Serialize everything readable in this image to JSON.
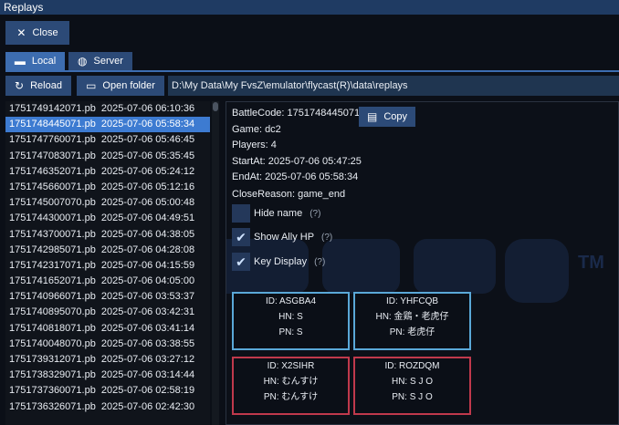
{
  "window": {
    "title": "Replays"
  },
  "toolbar": {
    "close_label": "Close"
  },
  "tabs": [
    {
      "label": "Local",
      "active": true
    },
    {
      "label": "Server",
      "active": false
    }
  ],
  "actions": {
    "reload_label": "Reload",
    "open_folder_label": "Open folder"
  },
  "path": "D:\\My Data\\My FvsZ\\emulator\\flycast(R)\\data\\replays",
  "replays": [
    {
      "label": "1751749142071.pb  2025-07-06 06:10:36"
    },
    {
      "label": "1751748445071.pb  2025-07-06 05:58:34",
      "selected": true
    },
    {
      "label": "1751747760071.pb  2025-07-06 05:46:45"
    },
    {
      "label": "1751747083071.pb  2025-07-06 05:35:45"
    },
    {
      "label": "1751746352071.pb  2025-07-06 05:24:12"
    },
    {
      "label": "1751745660071.pb  2025-07-06 05:12:16"
    },
    {
      "label": "1751745007070.pb  2025-07-06 05:00:48"
    },
    {
      "label": "1751744300071.pb  2025-07-06 04:49:51"
    },
    {
      "label": "1751743700071.pb  2025-07-06 04:38:05"
    },
    {
      "label": "1751742985071.pb  2025-07-06 04:28:08"
    },
    {
      "label": "1751742317071.pb  2025-07-06 04:15:59"
    },
    {
      "label": "1751741652071.pb  2025-07-06 04:05:00"
    },
    {
      "label": "1751740966071.pb  2025-07-06 03:53:37"
    },
    {
      "label": "1751740895070.pb  2025-07-06 03:42:31"
    },
    {
      "label": "1751740818071.pb  2025-07-06 03:41:14"
    },
    {
      "label": "1751740048070.pb  2025-07-06 03:38:55"
    },
    {
      "label": "1751739312071.pb  2025-07-06 03:27:12"
    },
    {
      "label": "1751738329071.pb  2025-07-06 03:14:44"
    },
    {
      "label": "1751737360071.pb  2025-07-06 02:58:19"
    },
    {
      "label": "1751736326071.pb  2025-07-06 02:42:30"
    }
  ],
  "details": {
    "battle_code": "BattleCode: 1751748445071",
    "copy_label": "Copy",
    "game": "Game: dc2",
    "players": "Players: 4",
    "start_at": "StartAt: 2025-07-06 05:47:25",
    "end_at": "EndAt: 2025-07-06 05:58:34",
    "close_reason": "CloseReason: game_end",
    "options": [
      {
        "label": "Hide name",
        "checked": false,
        "help": "(?)"
      },
      {
        "label": "Show Ally HP",
        "checked": true,
        "help": "(?)"
      },
      {
        "label": "Key Display",
        "checked": true,
        "help": "(?)"
      }
    ],
    "watermark": "TM"
  },
  "players": [
    {
      "team": "blue",
      "id": "ID: ASGBA4",
      "hn_label": "HN:",
      "hn": "S",
      "pn_label": "PN:",
      "pn": "S"
    },
    {
      "team": "blue",
      "id": "ID: YHFCQB",
      "hn_label": "HN:",
      "hn": "金鶏・老虎仔",
      "pn_label": "PN:",
      "pn": "老虎仔"
    },
    {
      "team": "red",
      "id": "ID: X2SIHR",
      "hn_label": "HN:",
      "hn": "むんすけ",
      "pn_label": "PN:",
      "pn": "むんすけ"
    },
    {
      "team": "red",
      "id": "ID: ROZDQM",
      "hn_label": "HN:",
      "hn": "S J O",
      "pn_label": "PN:",
      "pn": "S J O"
    }
  ],
  "colors": {
    "accent": "#3d7bd1",
    "button": "#2c4a77",
    "blue_team": "#5aa8d8",
    "red_team": "#c0394c"
  },
  "icons": {
    "close": "close-icon",
    "local": "folder-icon",
    "server": "globe-icon",
    "reload": "reload-icon",
    "open_folder": "folder-open-icon",
    "copy": "clipboard-icon",
    "check": "checkmark-icon"
  }
}
